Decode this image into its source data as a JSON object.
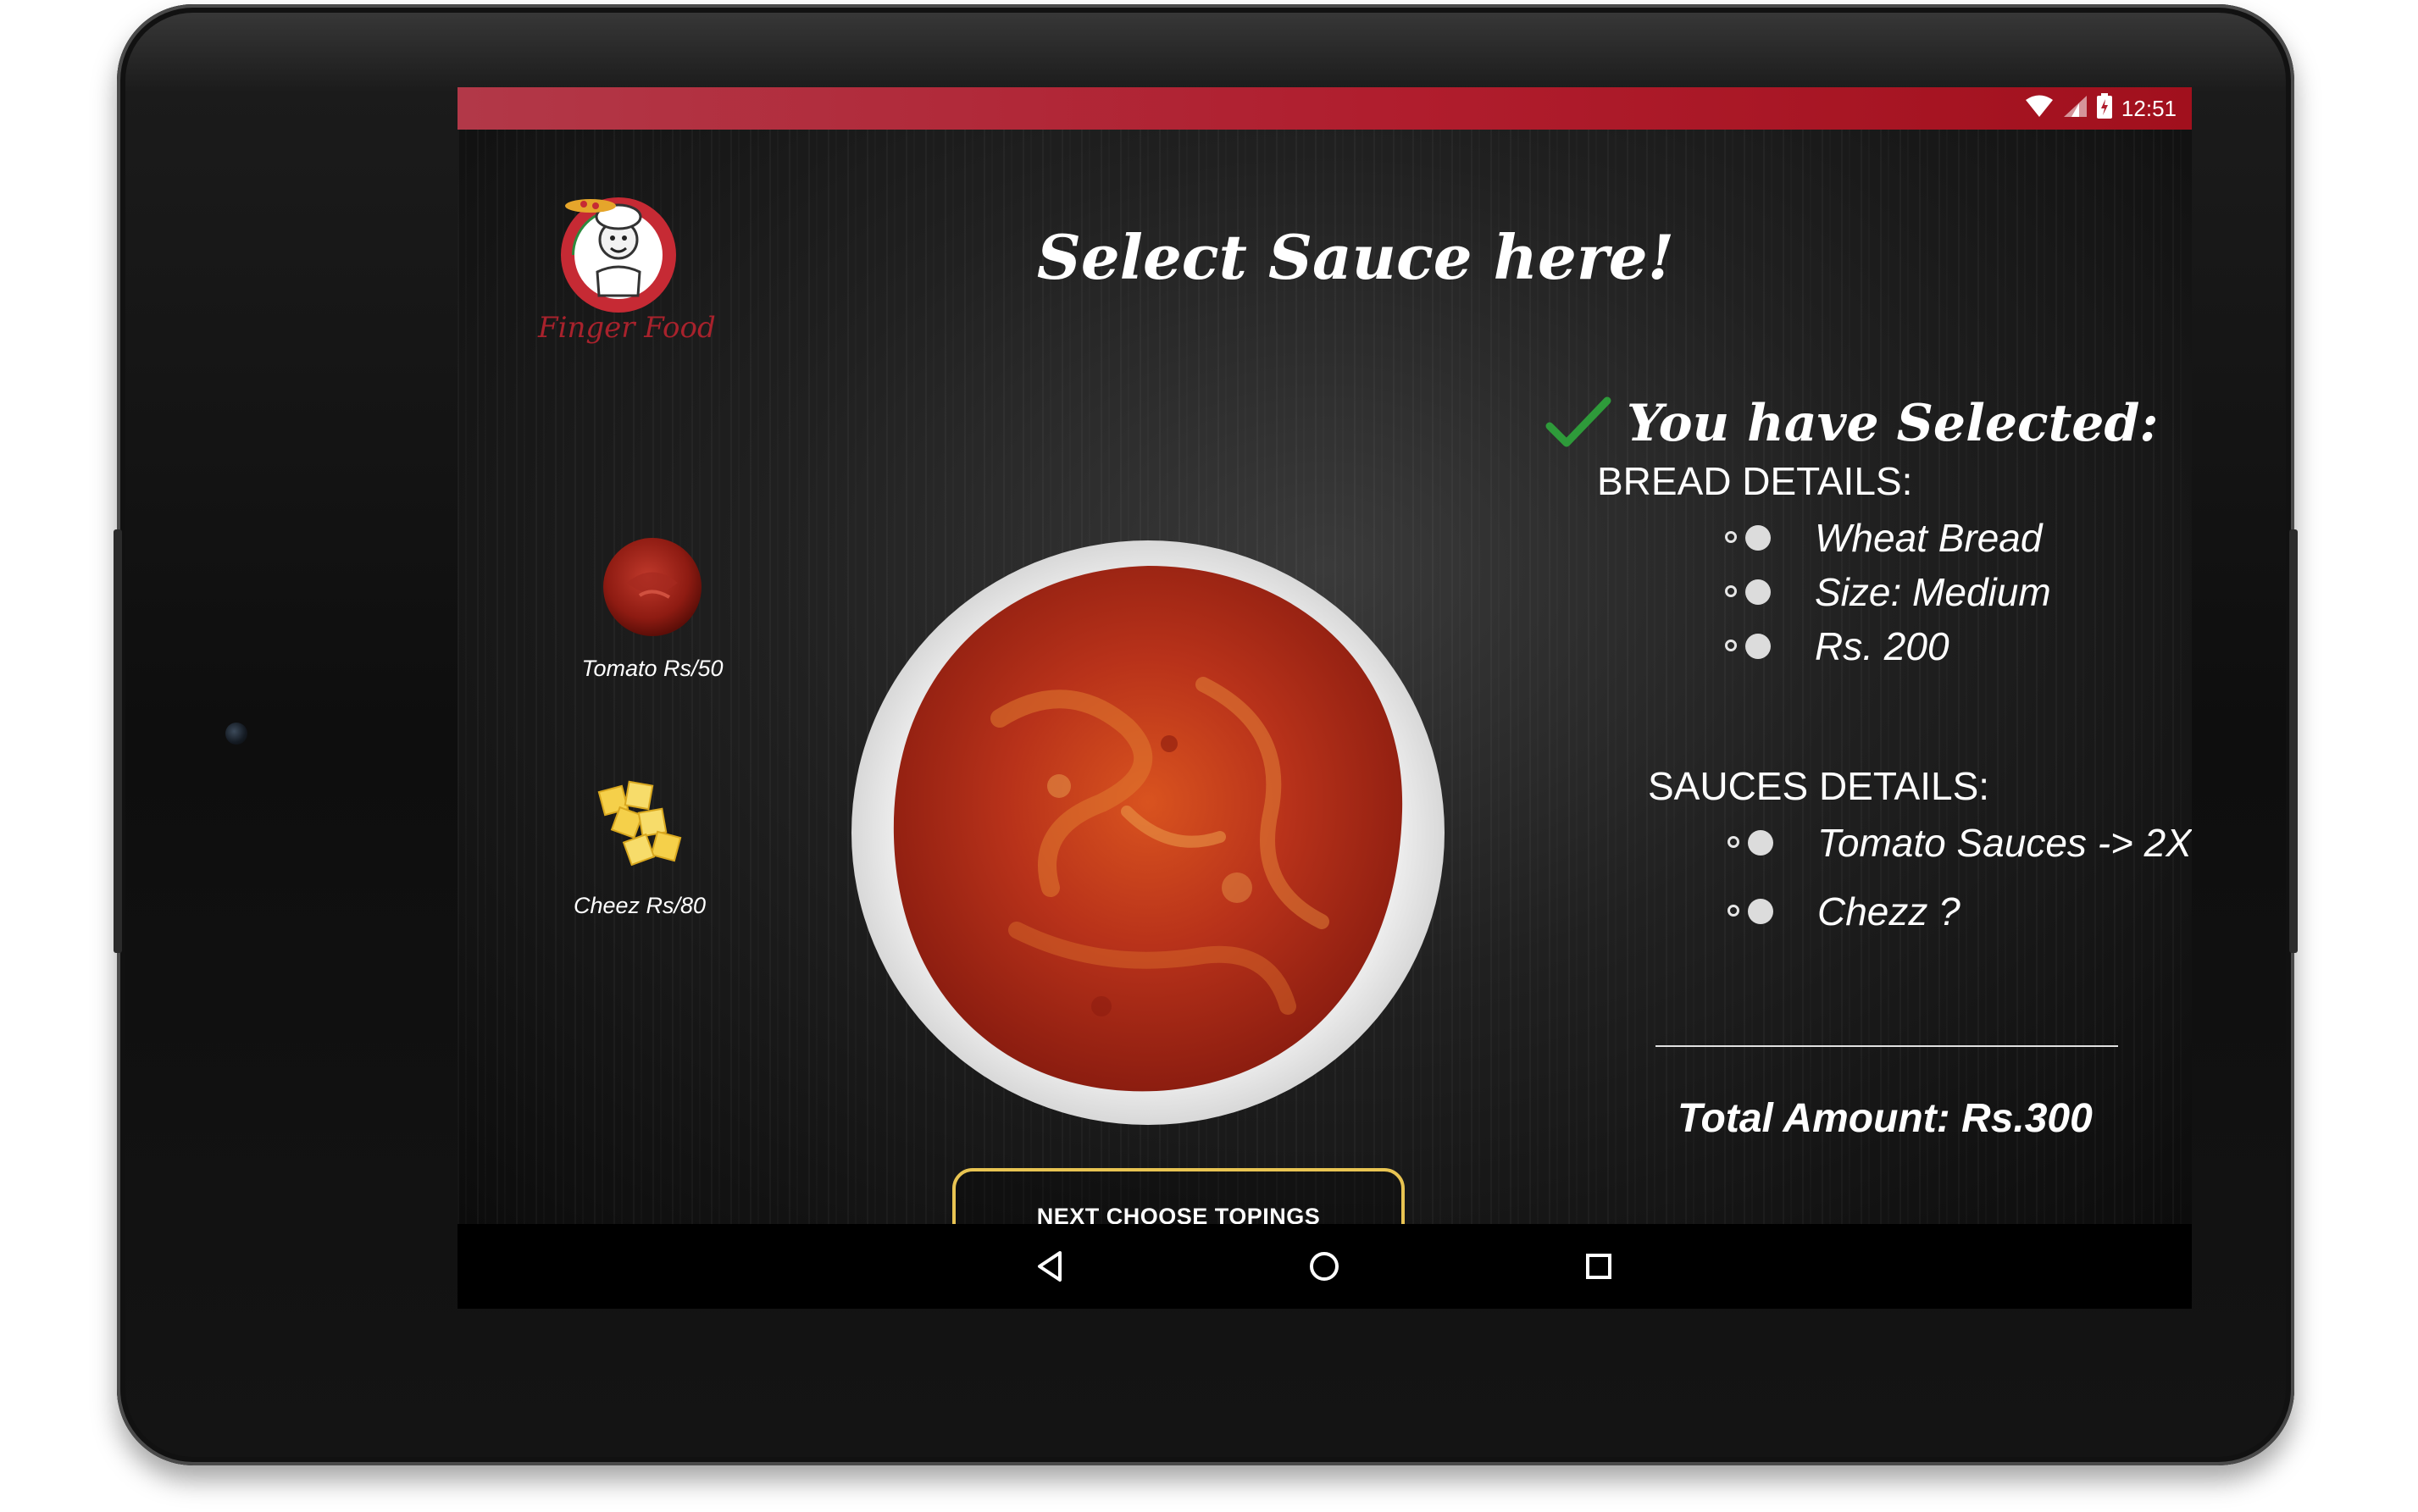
{
  "status_bar": {
    "time": "12:51"
  },
  "logo": {
    "text": "Finger Food"
  },
  "header": {
    "title": "Select Sauce here!"
  },
  "sauces": [
    {
      "label": "Tomato Rs/50"
    },
    {
      "label": "Cheez Rs/80"
    }
  ],
  "actions": {
    "next_label": "NEXT CHOOSE TOPINGS"
  },
  "summary": {
    "heading": "You have Selected:",
    "bread_title": "BREAD DETAILS:",
    "bread_items": [
      "Wheat Bread",
      "Size: Medium",
      "Rs. 200"
    ],
    "sauces_title": "SAUCES DETAILS:",
    "sauce_items": [
      "Tomato Sauces -> 2X",
      "Chezz ?"
    ],
    "total": "Total Amount: Rs.300"
  },
  "colors": {
    "status_bar": "#b01d2d",
    "button_border": "#e8c452",
    "check": "#2e9a3a"
  },
  "icons": {
    "status": [
      "wifi-icon",
      "signal-icon",
      "battery-icon"
    ],
    "nav": [
      "back-icon",
      "home-icon",
      "recents-icon"
    ],
    "summary": "checkmark-icon",
    "bullets": "double-dot-bullet-icon"
  }
}
